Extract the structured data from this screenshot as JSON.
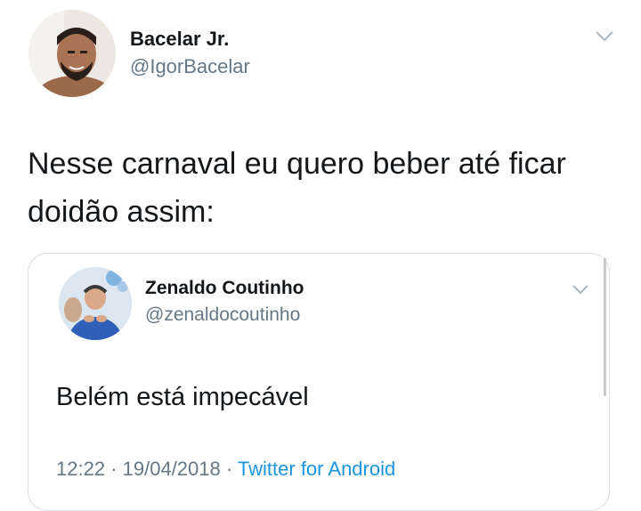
{
  "tweet": {
    "author": {
      "name": "Bacelar Jr.",
      "handle": "@IgorBacelar"
    },
    "text": "Nesse carnaval eu quero beber até ficar doidão assim:",
    "menu_icon": "chevron-down-icon"
  },
  "quoted_tweet": {
    "author": {
      "name": "Zenaldo Coutinho",
      "handle": "@zenaldocoutinho"
    },
    "text": "Belém está impecável",
    "time": "12:22",
    "separator": "·",
    "date": "19/04/2018",
    "source": "Twitter for Android",
    "menu_icon": "chevron-down-icon"
  },
  "colors": {
    "text": "#14171a",
    "secondary": "#657786",
    "link": "#1b95e0",
    "border": "#d8dee3"
  }
}
